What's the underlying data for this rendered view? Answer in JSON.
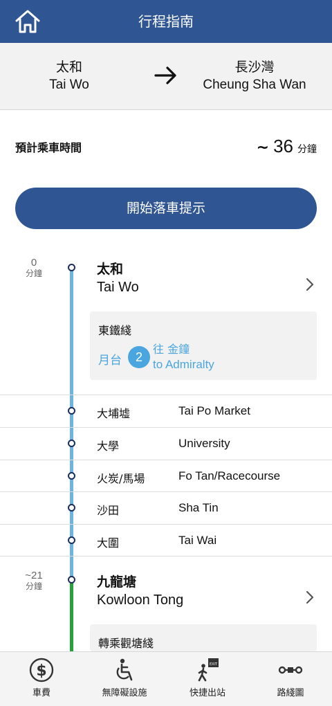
{
  "header": {
    "title": "行程指南",
    "home_icon": "home-icon"
  },
  "route": {
    "from_zh": "太和",
    "from_en": "Tai Wo",
    "to_zh": "長沙灣",
    "to_en": "Cheung Sha Wan",
    "arrow_icon": "arrow-right-icon"
  },
  "duration": {
    "label": "預計乘車時間",
    "tilde": "~",
    "value": "36",
    "unit": "分鐘"
  },
  "alert_button": {
    "label": "開始落車提示"
  },
  "journey": {
    "start": {
      "time_num": "0",
      "time_unit": "分鐘",
      "name_zh": "太和",
      "name_en": "Tai Wo",
      "line": "東鐵綫",
      "platform_label": "月台",
      "platform_number": "2",
      "towards_zh": "往 金鐘",
      "towards_en": "to Admiralty",
      "line_color": "#6db3e6"
    },
    "stops": [
      {
        "zh": "大埔墟",
        "en": "Tai Po Market"
      },
      {
        "zh": "大學",
        "en": "University"
      },
      {
        "zh": "火炭/馬場",
        "en": "Fo Tan/Racecourse"
      },
      {
        "zh": "沙田",
        "en": "Sha Tin"
      },
      {
        "zh": "大圍",
        "en": "Tai Wai"
      }
    ],
    "interchange": {
      "time_num": "~21",
      "time_unit": "分鐘",
      "name_zh": "九龍塘",
      "name_en": "Kowloon Tong",
      "transfer": "轉乘觀塘綫",
      "line_color": "#27a13a"
    }
  },
  "tabs": [
    {
      "label": "車費",
      "icon": "fare-dollar-icon"
    },
    {
      "label": "無障礙設施",
      "icon": "wheelchair-icon"
    },
    {
      "label": "快捷出站",
      "icon": "exit-icon"
    },
    {
      "label": "路綫圖",
      "icon": "route-map-icon"
    }
  ],
  "colors": {
    "brand": "#2f5593",
    "line_blue": "#6db3e6",
    "line_green": "#27a13a",
    "platform": "#4ba6df"
  }
}
